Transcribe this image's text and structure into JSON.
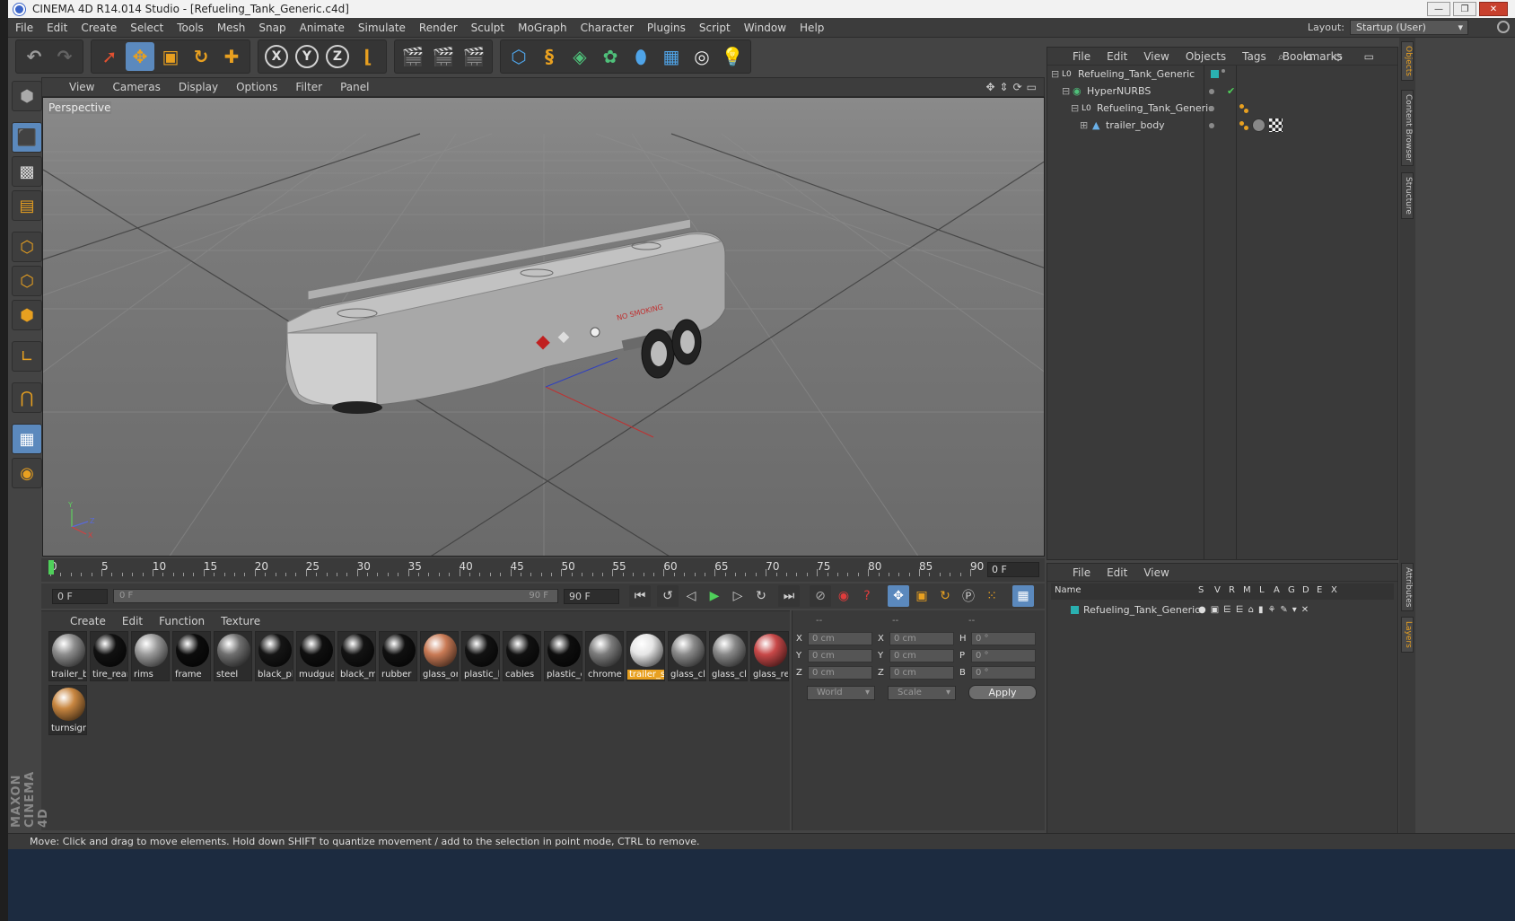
{
  "window": {
    "title": "CINEMA 4D R14.014 Studio - [Refueling_Tank_Generic.c4d]",
    "buttons": [
      "—",
      "❐",
      "✕"
    ]
  },
  "menubar": {
    "items": [
      "File",
      "Edit",
      "Create",
      "Select",
      "Tools",
      "Mesh",
      "Snap",
      "Animate",
      "Simulate",
      "Render",
      "Sculpt",
      "MoGraph",
      "Character",
      "Plugins",
      "Script",
      "Window",
      "Help"
    ],
    "layout_label": "Layout:",
    "layout_value": "Startup (User)"
  },
  "toolbar": {
    "axes": [
      "X",
      "Y",
      "Z"
    ]
  },
  "viewport": {
    "menu": [
      "View",
      "Cameras",
      "Display",
      "Options",
      "Filter",
      "Panel"
    ],
    "label": "Perspective",
    "sign_text": "NO SMOKING",
    "axis_labels": [
      "Y",
      "Z",
      "X"
    ]
  },
  "timeline": {
    "ticks": [
      "0",
      "5",
      "10",
      "15",
      "20",
      "25",
      "30",
      "35",
      "40",
      "45",
      "50",
      "55",
      "60",
      "65",
      "70",
      "75",
      "80",
      "85",
      "90"
    ],
    "current_frame": "0 F"
  },
  "transport": {
    "start": "0 F",
    "slider_start": "0 F",
    "slider_end": "90 F",
    "end": "90 F"
  },
  "materials": {
    "menu": [
      "Create",
      "Edit",
      "Function",
      "Texture"
    ],
    "items": [
      {
        "name": "trailer_b",
        "color": "#8c8c8c"
      },
      {
        "name": "tire_rear",
        "color": "#111111"
      },
      {
        "name": "rims",
        "color": "#9a9a9a"
      },
      {
        "name": "frame",
        "color": "#0c0c0c"
      },
      {
        "name": "steel",
        "color": "#6f6f6f"
      },
      {
        "name": "black_pl",
        "color": "#151515"
      },
      {
        "name": "mudgua",
        "color": "#0f0f0f"
      },
      {
        "name": "black_m",
        "color": "#131313"
      },
      {
        "name": "rubber",
        "color": "#101010"
      },
      {
        "name": "glass_or",
        "color": "#c97a55"
      },
      {
        "name": "plastic_l",
        "color": "#121212"
      },
      {
        "name": "cables",
        "color": "#111111"
      },
      {
        "name": "plastic_c",
        "color": "#0e0e0e"
      },
      {
        "name": "chrome",
        "color": "#7c7c7c"
      },
      {
        "name": "trailer_s",
        "color": "#e6e6e6",
        "selected": true
      },
      {
        "name": "glass_cl",
        "color": "#8a8a8a"
      },
      {
        "name": "glass_cl",
        "color": "#888888"
      },
      {
        "name": "glass_re",
        "color": "#c84848"
      },
      {
        "name": "turnsigr",
        "color": "#c88640"
      }
    ]
  },
  "coords": {
    "headers": [
      "--",
      "--",
      "--"
    ],
    "rows": [
      {
        "a": "X",
        "av": "0 cm",
        "b": "X",
        "bv": "0 cm",
        "c": "H",
        "cv": "0 °"
      },
      {
        "a": "Y",
        "av": "0 cm",
        "b": "Y",
        "bv": "0 cm",
        "c": "P",
        "cv": "0 °"
      },
      {
        "a": "Z",
        "av": "0 cm",
        "b": "Z",
        "bv": "0 cm",
        "c": "B",
        "cv": "0 °"
      }
    ],
    "mode": "World",
    "type": "Scale",
    "apply": "Apply"
  },
  "objects": {
    "menu": [
      "File",
      "Edit",
      "View",
      "Objects",
      "Tags",
      "Bookmarks"
    ],
    "tree": [
      {
        "label": "Refueling_Tank_Generic",
        "icon": "L0"
      },
      {
        "label": "HyperNURBS",
        "icon": "◉"
      },
      {
        "label": "Refueling_Tank_Generic",
        "icon": "L0"
      },
      {
        "label": "trailer_body",
        "icon": "▲"
      }
    ]
  },
  "layers": {
    "menu": [
      "File",
      "Edit",
      "View"
    ],
    "columns": [
      "Name",
      "S",
      "V",
      "R",
      "M",
      "L",
      "A",
      "G",
      "D",
      "E",
      "X"
    ],
    "rows": [
      {
        "label": "Refueling_Tank_Generic"
      }
    ]
  },
  "sidetabs": [
    "Objects",
    "Content Browser",
    "Structure",
    "Attributes",
    "Layers"
  ],
  "status": "Move: Click and drag to move elements. Hold down SHIFT to quantize movement / add to the selection in point mode, CTRL to remove.",
  "brand": "MAXON CINEMA 4D"
}
